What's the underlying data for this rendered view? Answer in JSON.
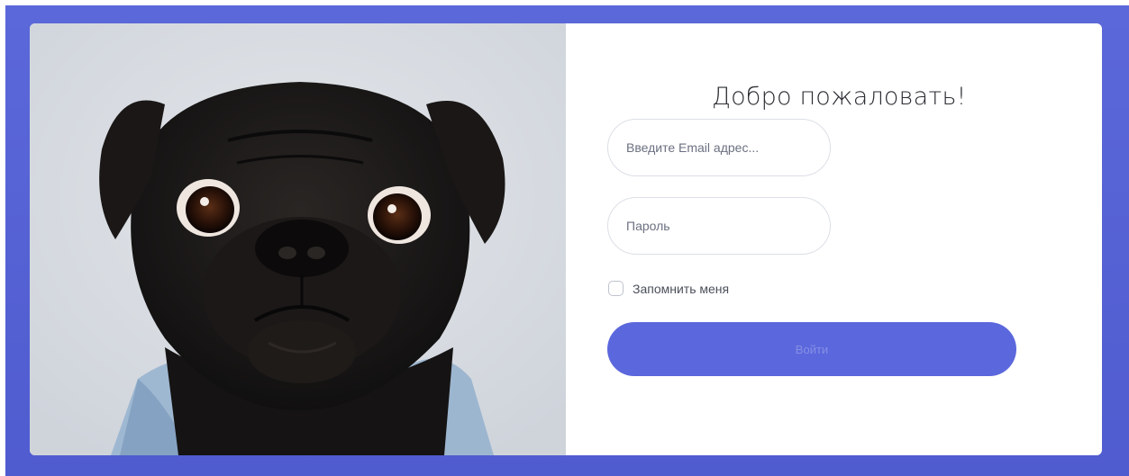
{
  "login": {
    "title": "Добро пожаловать!",
    "email_placeholder": "Введите Email адрес...",
    "password_placeholder": "Пароль",
    "remember_label": "Запомнить меня",
    "submit_label": "Войти"
  },
  "colors": {
    "frame_background": "#5b68d9",
    "button_background": "#5b67dc",
    "button_text": "#8690e6"
  },
  "image": {
    "subject": "pug-photo"
  }
}
